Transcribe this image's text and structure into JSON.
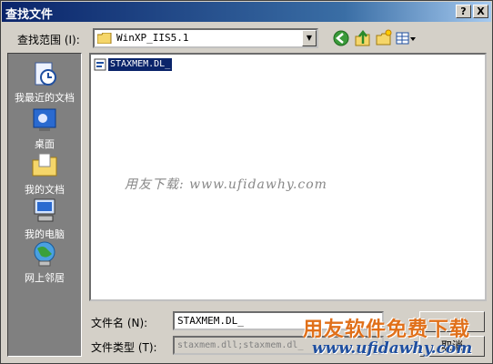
{
  "window": {
    "title": "查找文件",
    "help_glyph": "?",
    "close_glyph": "X"
  },
  "toolbar": {
    "look_in_label": "查找范围 (I):",
    "look_in_value": "WinXP_IIS5.1",
    "icons": [
      "back-icon",
      "up-folder-icon",
      "new-folder-icon",
      "view-menu-icon"
    ]
  },
  "places": [
    {
      "label": "我最近的文档",
      "icon": "recent-documents-icon"
    },
    {
      "label": "桌面",
      "icon": "desktop-icon"
    },
    {
      "label": "我的文档",
      "icon": "my-documents-icon"
    },
    {
      "label": "我的电脑",
      "icon": "my-computer-icon"
    },
    {
      "label": "网上邻居",
      "icon": "network-places-icon"
    }
  ],
  "files": [
    {
      "name": "STAXMEM.DL_",
      "selected": true
    }
  ],
  "form": {
    "filename_label": "文件名 (N):",
    "filename_value": "STAXMEM.DL_",
    "filetype_label": "文件类型 (T):",
    "filetype_value": "staxmem.dll;staxmem.dl_",
    "open_label": "",
    "cancel_label": "取消"
  },
  "watermarks": {
    "center": "用友下载: www.ufidawhy.com",
    "brand_cn": "用友软件免费下载",
    "brand_url": "www.ufidawhy.com"
  },
  "colors": {
    "title_bar": "#0a246a",
    "selection": "#0a246a",
    "face": "#d4d0c8",
    "places_bar": "#808080"
  }
}
